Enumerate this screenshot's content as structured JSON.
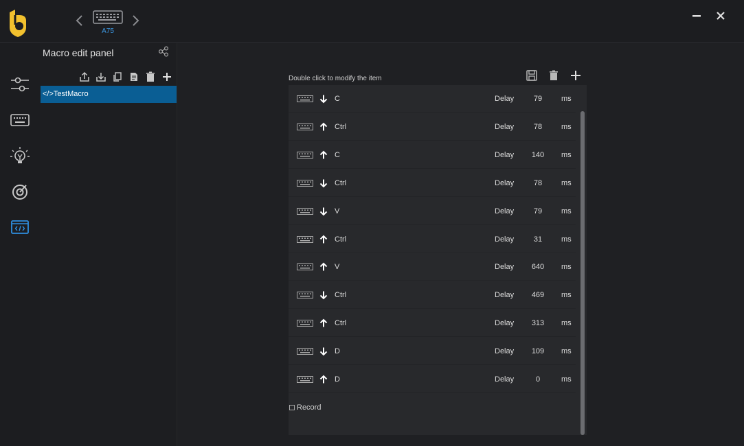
{
  "device": {
    "name": "A75"
  },
  "panel": {
    "title": "Macro edit panel"
  },
  "macros": [
    {
      "label": "</>TestMacro",
      "selected": true
    }
  ],
  "list": {
    "hint": "Double click to modify the item",
    "delay_label": "Delay",
    "unit": "ms",
    "rows": [
      {
        "direction": "down",
        "key": "C",
        "delay": "79"
      },
      {
        "direction": "up",
        "key": "Ctrl",
        "delay": "78"
      },
      {
        "direction": "up",
        "key": "C",
        "delay": "140"
      },
      {
        "direction": "down",
        "key": "Ctrl",
        "delay": "78"
      },
      {
        "direction": "down",
        "key": "V",
        "delay": "79"
      },
      {
        "direction": "up",
        "key": "Ctrl",
        "delay": "31"
      },
      {
        "direction": "up",
        "key": "V",
        "delay": "640"
      },
      {
        "direction": "down",
        "key": "Ctrl",
        "delay": "469"
      },
      {
        "direction": "up",
        "key": "Ctrl",
        "delay": "313"
      },
      {
        "direction": "down",
        "key": "D",
        "delay": "109"
      },
      {
        "direction": "up",
        "key": "D",
        "delay": "0"
      }
    ]
  },
  "record": {
    "label": "Record"
  },
  "colors": {
    "accent": "#f2c12e",
    "selection": "#0a5e94",
    "active_nav": "#2f8fe0"
  }
}
